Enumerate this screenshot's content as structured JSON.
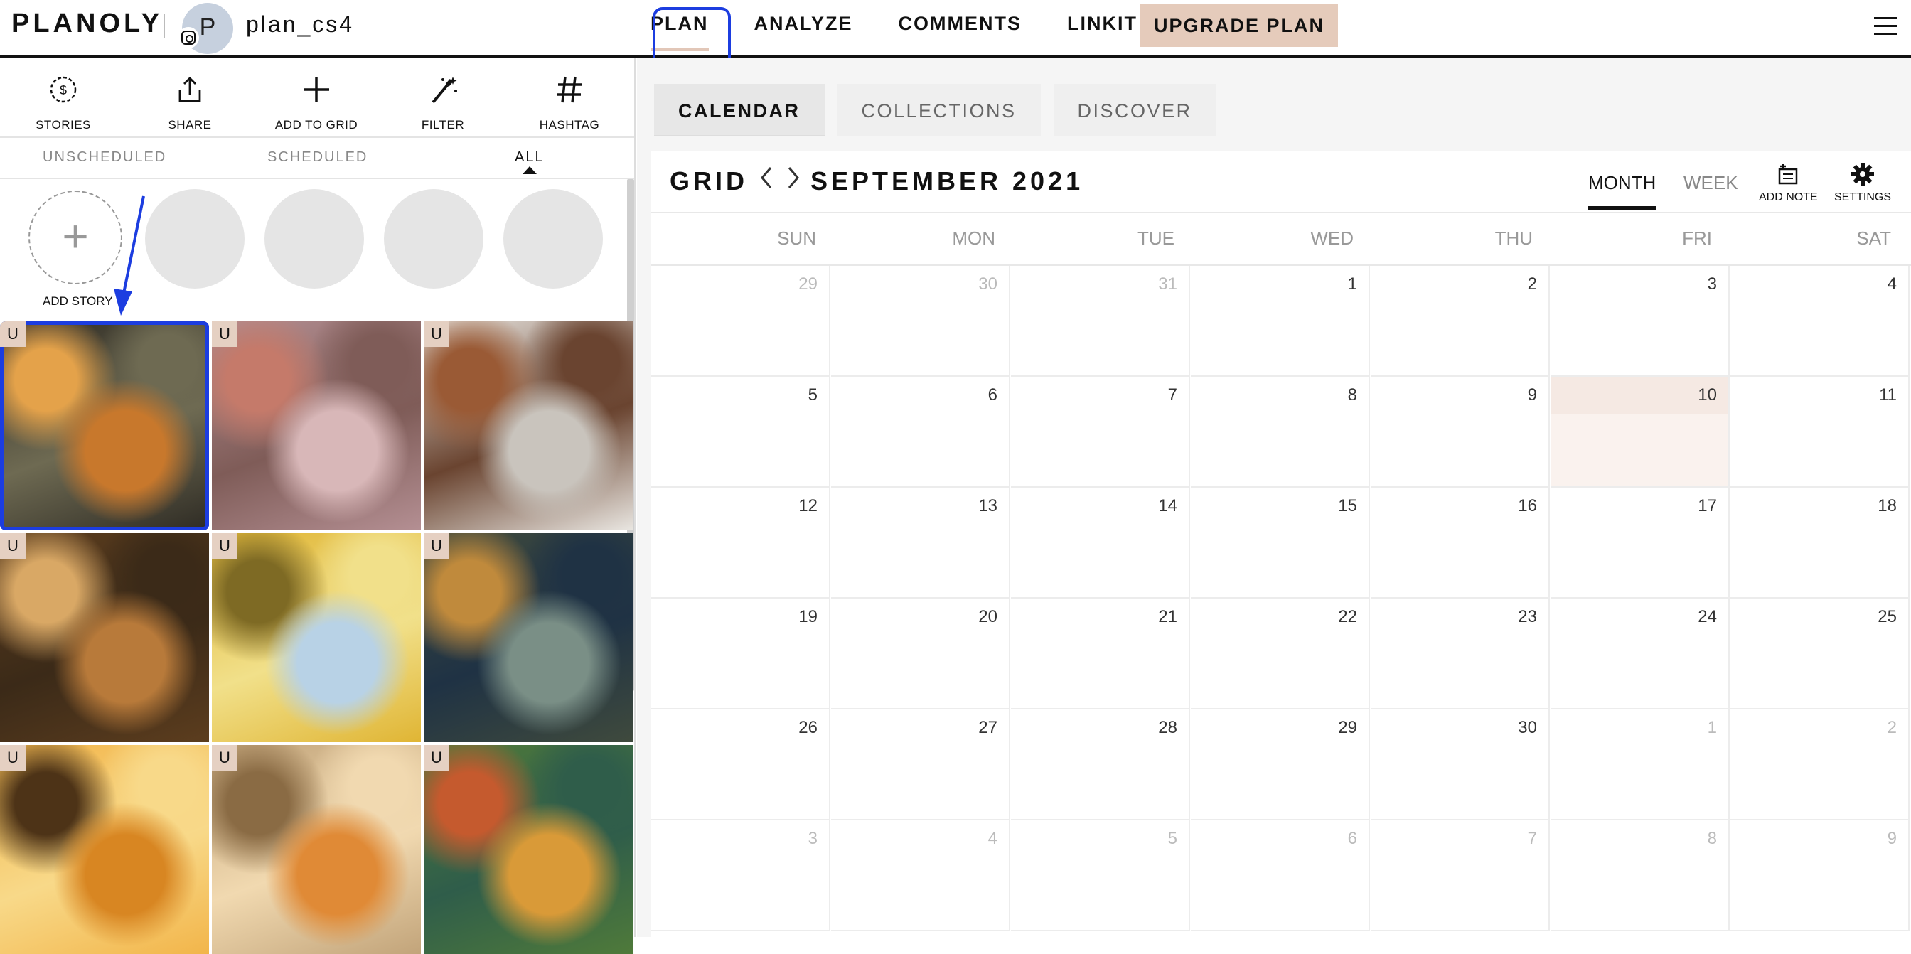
{
  "brand": "PLANOLY",
  "account": {
    "avatar_letter": "P",
    "username": "plan_cs4"
  },
  "nav": {
    "items": [
      "PLAN",
      "ANALYZE",
      "COMMENTS",
      "LINKIT"
    ],
    "upgrade": "UPGRADE PLAN"
  },
  "tools": {
    "stories": "STORIES",
    "share": "SHARE",
    "add_to_grid": "ADD TO GRID",
    "filter": "FILTER",
    "hashtag": "HASHTAG"
  },
  "filters": {
    "unscheduled": "UNSCHEDULED",
    "scheduled": "SCHEDULED",
    "all": "ALL"
  },
  "stories": {
    "add_label": "ADD STORY"
  },
  "grid_tiles": [
    {
      "badge": "U",
      "subject": "pumpkin on gourds",
      "colors": [
        "#2e2b24",
        "#c8782c",
        "#e4a24a",
        "#6e6a52"
      ]
    },
    {
      "badge": "U",
      "subject": "pink pumpkins",
      "colors": [
        "#b48f93",
        "#d8b7b8",
        "#c57a6a",
        "#7f5c58"
      ]
    },
    {
      "badge": "U",
      "subject": "white leaf",
      "colors": [
        "#e9e6e1",
        "#c9c4bd",
        "#9a5a35",
        "#6a4430"
      ]
    },
    {
      "badge": "U",
      "subject": "autumn forest path",
      "colors": [
        "#5c3d1e",
        "#b87a3a",
        "#d9a865",
        "#3b2a18"
      ]
    },
    {
      "badge": "U",
      "subject": "yellow leaves sky",
      "colors": [
        "#e0b534",
        "#b8d2e6",
        "#7e6a24",
        "#f1e08a"
      ]
    },
    {
      "badge": "U",
      "subject": "canoe with leaf",
      "colors": [
        "#3f4a3d",
        "#7a8f86",
        "#c08a3c",
        "#1f3244"
      ]
    },
    {
      "badge": "U",
      "subject": "golden tree sunset",
      "colors": [
        "#f2b54a",
        "#d88622",
        "#4d3317",
        "#f8d989"
      ]
    },
    {
      "badge": "U",
      "subject": "pumpkin with wheat",
      "colors": [
        "#c2a47a",
        "#e08a36",
        "#8a6b44",
        "#f1d9b0"
      ]
    },
    {
      "badge": "U",
      "subject": "aerial autumn forest",
      "colors": [
        "#4f7a3a",
        "#d99a38",
        "#c55a2e",
        "#2f5d4a"
      ]
    }
  ],
  "right_tabs": [
    "CALENDAR",
    "COLLECTIONS",
    "DISCOVER"
  ],
  "calendar": {
    "grid_label": "GRID",
    "month_title": "SEPTEMBER 2021",
    "view_month": "MONTH",
    "view_week": "WEEK",
    "add_note": "ADD NOTE",
    "settings": "SETTINGS",
    "weekdays": [
      "SUN",
      "MON",
      "TUE",
      "WED",
      "THU",
      "FRI",
      "SAT"
    ],
    "weeks": [
      [
        {
          "d": "29",
          "m": true
        },
        {
          "d": "30",
          "m": true
        },
        {
          "d": "31",
          "m": true
        },
        {
          "d": "1"
        },
        {
          "d": "2"
        },
        {
          "d": "3"
        },
        {
          "d": "4"
        }
      ],
      [
        {
          "d": "5"
        },
        {
          "d": "6"
        },
        {
          "d": "7"
        },
        {
          "d": "8"
        },
        {
          "d": "9"
        },
        {
          "d": "10",
          "today": true
        },
        {
          "d": "11"
        }
      ],
      [
        {
          "d": "12"
        },
        {
          "d": "13"
        },
        {
          "d": "14"
        },
        {
          "d": "15"
        },
        {
          "d": "16"
        },
        {
          "d": "17"
        },
        {
          "d": "18"
        }
      ],
      [
        {
          "d": "19"
        },
        {
          "d": "20"
        },
        {
          "d": "21"
        },
        {
          "d": "22"
        },
        {
          "d": "23"
        },
        {
          "d": "24"
        },
        {
          "d": "25"
        }
      ],
      [
        {
          "d": "26"
        },
        {
          "d": "27"
        },
        {
          "d": "28"
        },
        {
          "d": "29"
        },
        {
          "d": "30"
        },
        {
          "d": "1",
          "m": true
        },
        {
          "d": "2",
          "m": true
        }
      ],
      [
        {
          "d": "3",
          "m": true
        },
        {
          "d": "4",
          "m": true
        },
        {
          "d": "5",
          "m": true
        },
        {
          "d": "6",
          "m": true
        },
        {
          "d": "7",
          "m": true
        },
        {
          "d": "8",
          "m": true
        },
        {
          "d": "9",
          "m": true
        }
      ]
    ]
  },
  "colors": {
    "accent_peach": "#e5cbbb",
    "highlight_blue": "#1c3de0"
  }
}
